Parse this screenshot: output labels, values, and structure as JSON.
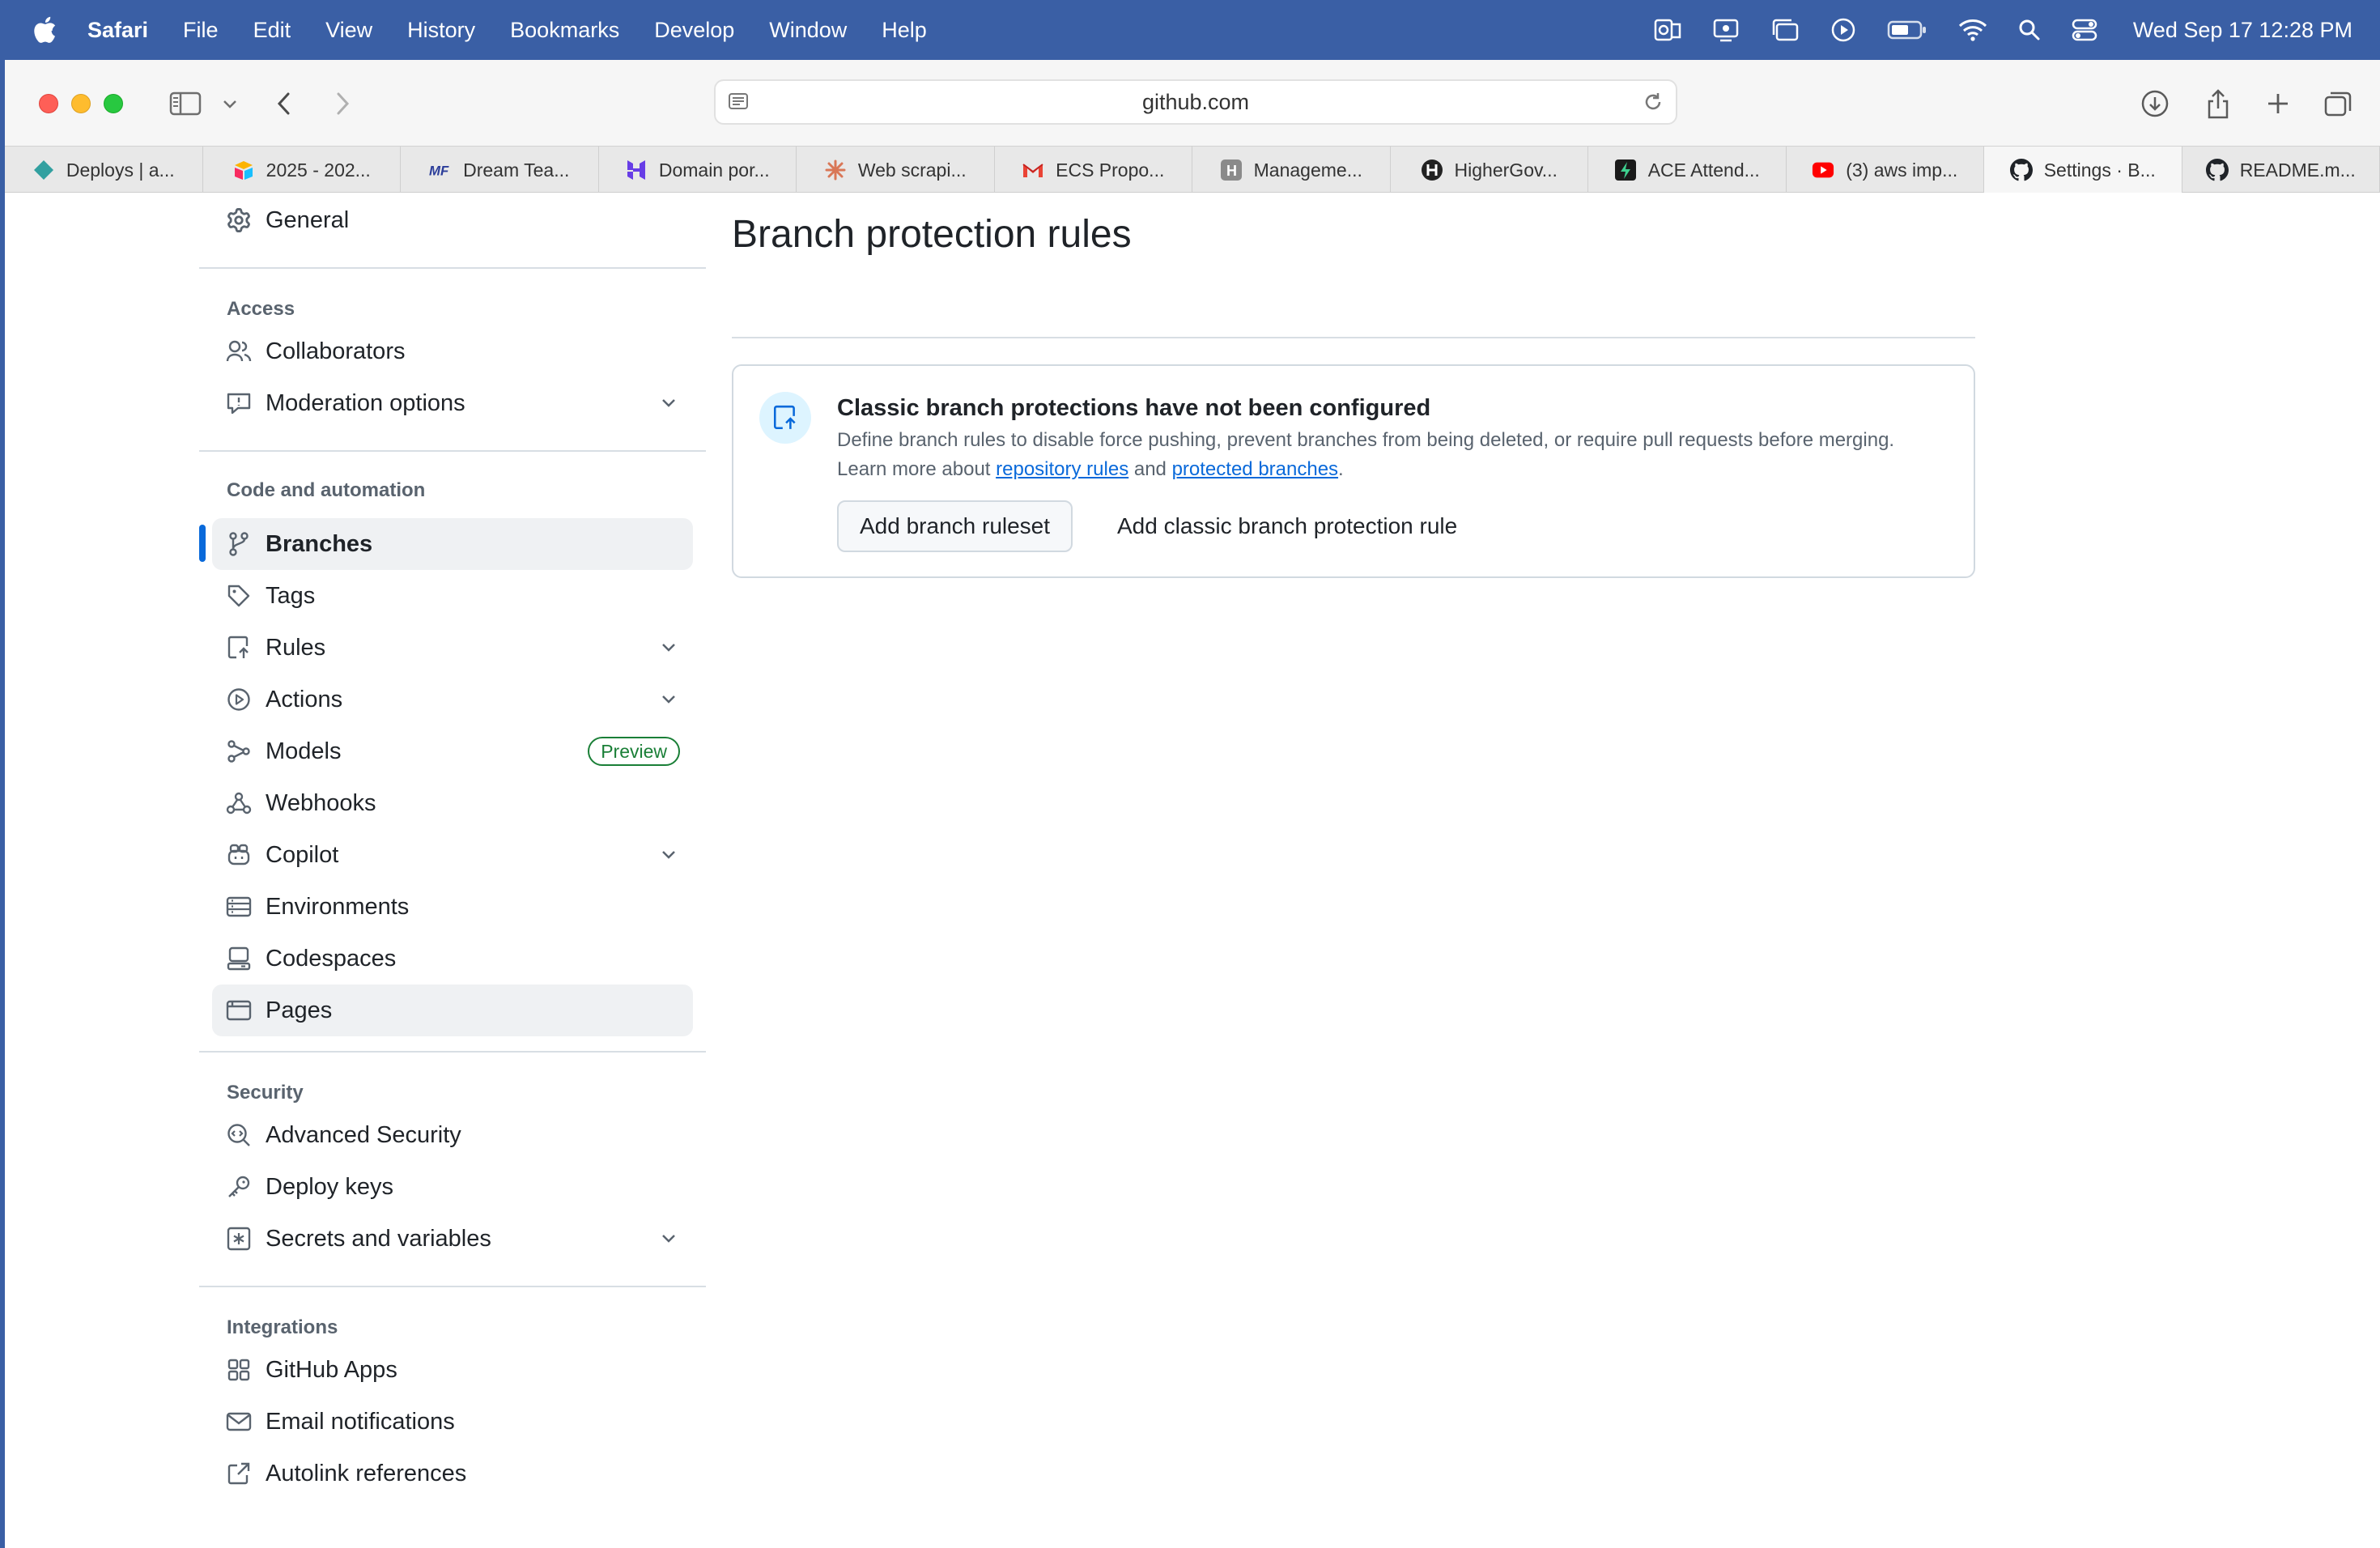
{
  "menubar": {
    "app_name": "Safari",
    "items": [
      "File",
      "Edit",
      "View",
      "History",
      "Bookmarks",
      "Develop",
      "Window",
      "Help"
    ],
    "clock": "Wed Sep 17  12:28 PM"
  },
  "browser": {
    "url": "github.com",
    "tabs": [
      {
        "label": "Deploys | a...",
        "icon": "netlify-icon"
      },
      {
        "label": "2025 - 202...",
        "icon": "airtable-icon"
      },
      {
        "label": "Dream Tea...",
        "icon": "mf-icon"
      },
      {
        "label": "Domain por...",
        "icon": "hostinger-icon"
      },
      {
        "label": "Web scrapi...",
        "icon": "claude-icon"
      },
      {
        "label": "ECS Propo...",
        "icon": "gmail-icon"
      },
      {
        "label": "Manageme...",
        "icon": "h-icon"
      },
      {
        "label": "HigherGov...",
        "icon": "highergov-icon"
      },
      {
        "label": "ACE Attend...",
        "icon": "ace-icon"
      },
      {
        "label": "(3) aws imp...",
        "icon": "youtube-icon"
      },
      {
        "label": "Settings · B...",
        "icon": "github-icon"
      },
      {
        "label": "README.m...",
        "icon": "github-icon"
      }
    ]
  },
  "sidebar": {
    "general": "General",
    "sections": {
      "access": "Access",
      "code": "Code and automation",
      "security": "Security",
      "integrations": "Integrations"
    },
    "items": {
      "collaborators": "Collaborators",
      "moderation": "Moderation options",
      "branches": "Branches",
      "tags": "Tags",
      "rules": "Rules",
      "actions": "Actions",
      "models": "Models",
      "models_badge": "Preview",
      "webhooks": "Webhooks",
      "copilot": "Copilot",
      "environments": "Environments",
      "codespaces": "Codespaces",
      "pages": "Pages",
      "advanced_security": "Advanced Security",
      "deploy_keys": "Deploy keys",
      "secrets": "Secrets and variables",
      "github_apps": "GitHub Apps",
      "email_notifications": "Email notifications",
      "autolink": "Autolink references"
    }
  },
  "main": {
    "title": "Branch protection rules",
    "blank_title": "Classic branch protections have not been configured",
    "blank_desc_1": "Define branch rules to disable force pushing, prevent branches from being deleted, or require pull requests before merging. Learn more about ",
    "link_repo_rules": "repository rules",
    "desc_and": " and ",
    "link_protected": "protected branches",
    "desc_end": ".",
    "btn_ruleset": "Add branch ruleset",
    "btn_classic": "Add classic branch protection rule"
  },
  "colors": {
    "menubar": "#3a5fa5",
    "accent": "#0969da",
    "preview_badge": "#1a7f37"
  }
}
